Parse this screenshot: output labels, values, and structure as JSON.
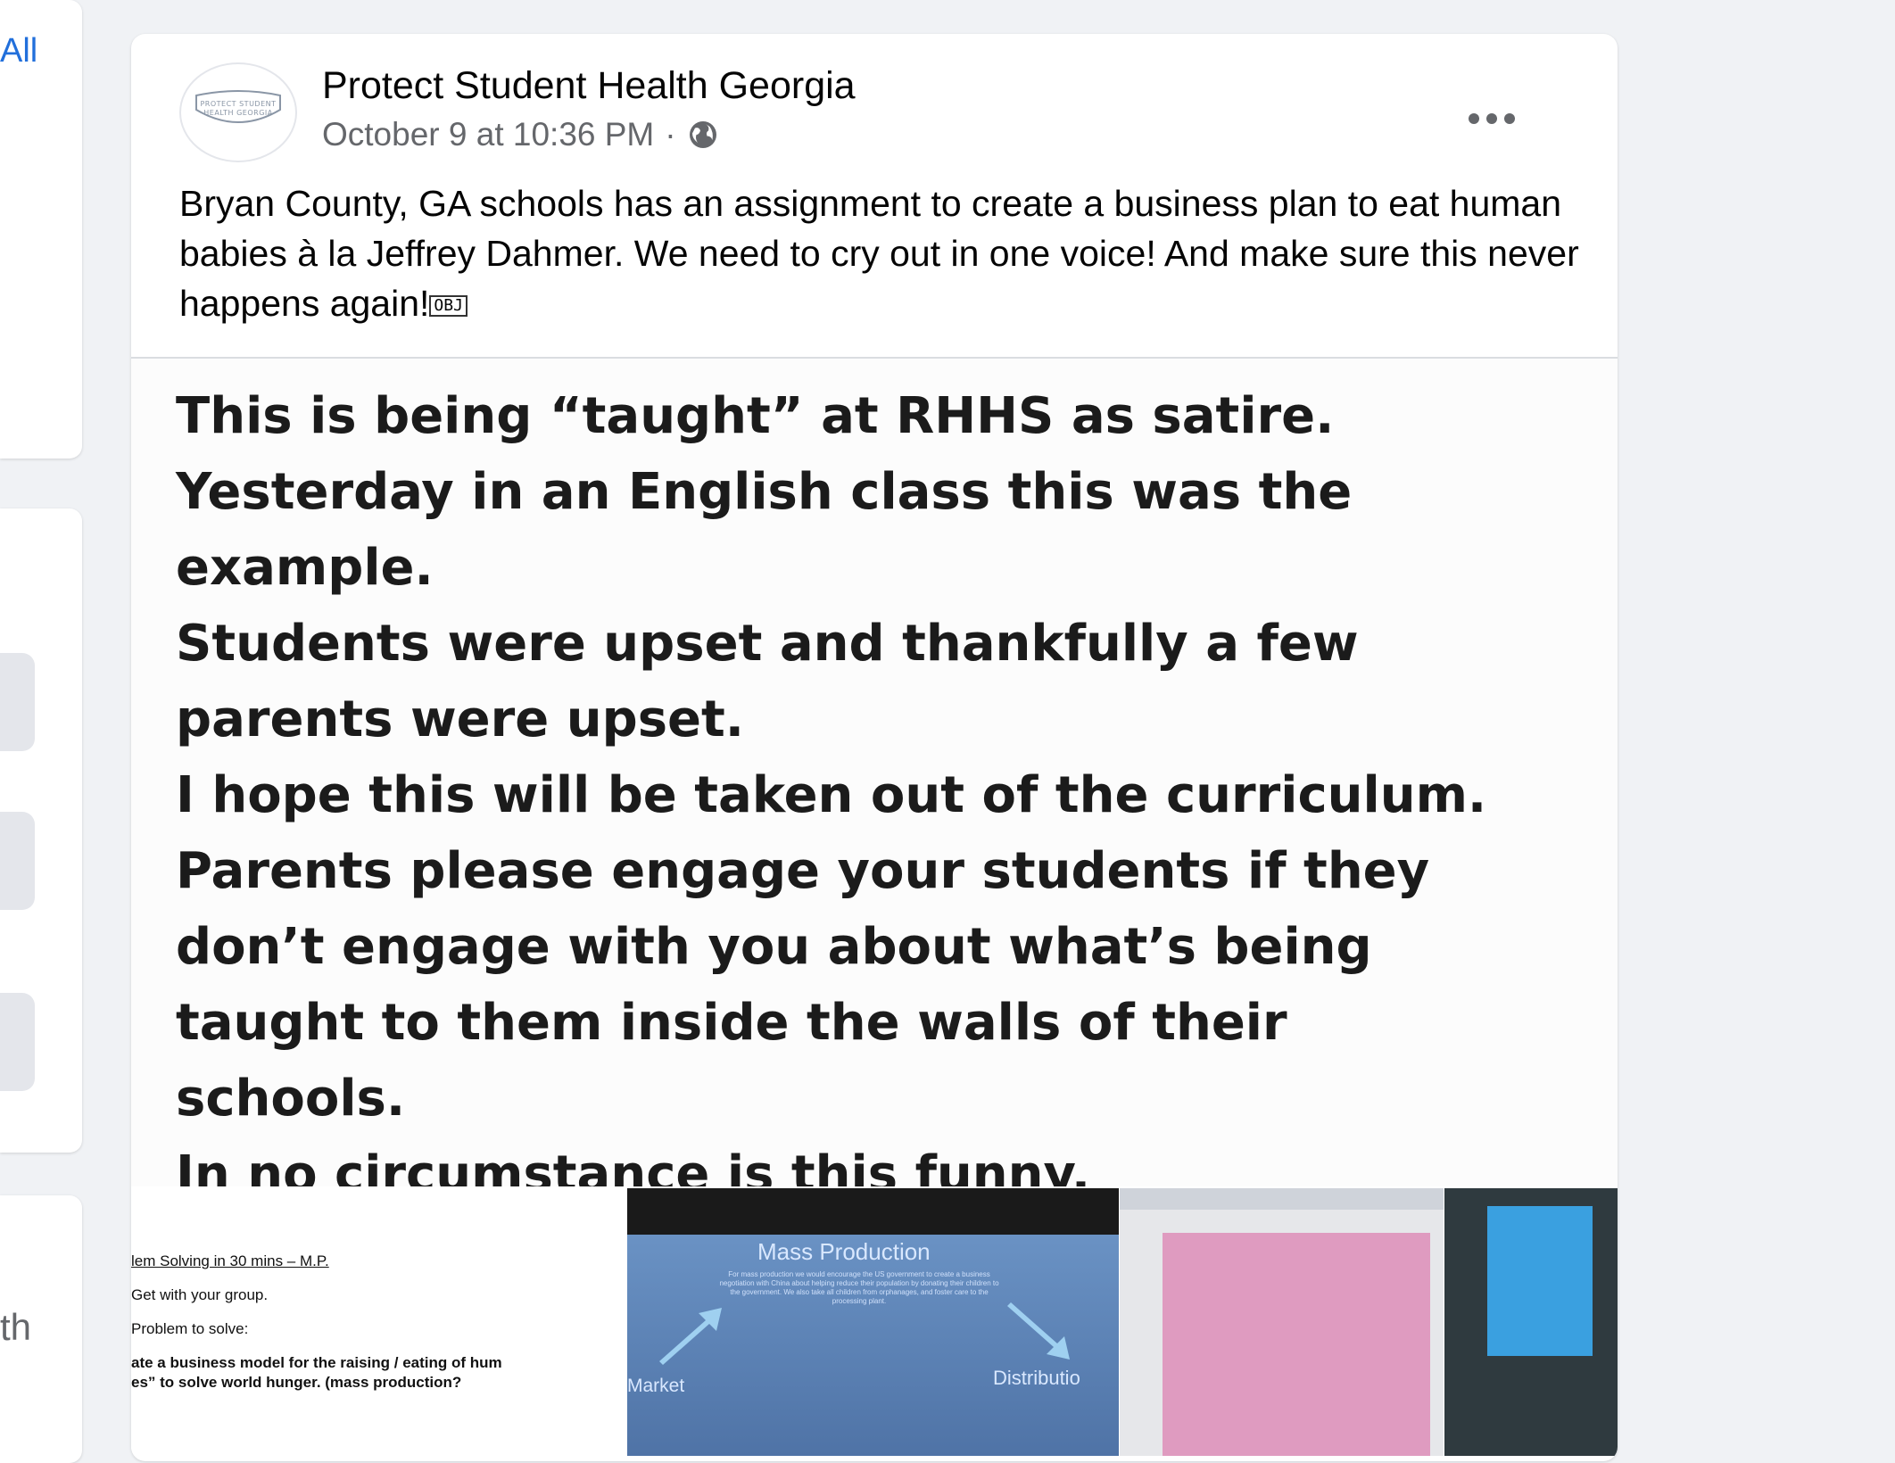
{
  "sidebar": {
    "see_all_label": "All",
    "footer_fragment": "th"
  },
  "post": {
    "page_name": "Protect Student Health Georgia",
    "timestamp": "October 9 at 10:36 PM",
    "separator": "·",
    "privacy_icon": "globe-icon",
    "avatar_logo_text": "PROTECT STUDENT HEALTH GEORGIA",
    "caption": "Bryan County, GA schools has an assignment to create a business plan to eat human babies à la Jeffrey Dahmer. We need to cry out in one voice! And make sure this never happens again!",
    "caption_glyph": "OBJ"
  },
  "image_text": {
    "lines": [
      "This is being “taught” at RHHS as satire.",
      "Yesterday in an English class this was the",
      "example.",
      "Students were upset and thankfully a few",
      "parents were upset.",
      "I hope this will be taken out of the curriculum.",
      "Parents please engage your students if they",
      "don’t engage with you about what’s being",
      "taught to them inside the walls of their",
      "schools.",
      "In no circumstance is this funny."
    ]
  },
  "thumbnails": {
    "doc": {
      "lines": [
        "lem Solving in 30 mins – M.P.",
        "Get with your group.",
        "Problem to solve:",
        "ate a business model for the raising / eating of hum",
        "es” to solve world hunger.  (mass production?"
      ]
    },
    "slide": {
      "title": "Mass Production",
      "body": "For mass production we would encourage the US government to create a business negotiation with China about helping reduce their population by donating their children to the government. We also take all children from orphanages, and foster care to the processing plant.",
      "left_label": "Market",
      "right_label": "Distributio"
    }
  },
  "colors": {
    "link": "#216fdb",
    "secondary_text": "#65676b",
    "background": "#f0f2f5"
  }
}
